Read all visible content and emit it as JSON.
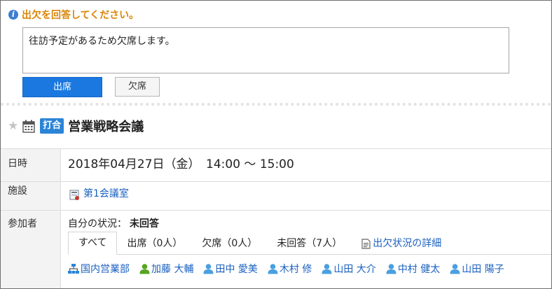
{
  "response": {
    "prompt": "出欠を回答してください。",
    "comment": "往訪予定があるため欠席します。",
    "attend_label": "出席",
    "absent_label": "欠席"
  },
  "event": {
    "menu": "打合",
    "title": "営業戦略会議"
  },
  "details": {
    "date_label": "日時",
    "date_value": "2018年04月27日（金）　14:00 ～ 15:00",
    "facility_label": "施設",
    "facility_value": "第1会議室",
    "attendees_label": "参加者",
    "own_status_label": "自分の状況：",
    "own_status_value": "未回答"
  },
  "tabs": [
    {
      "label": "すべて"
    },
    {
      "label": "出席（0人）"
    },
    {
      "label": "欠席（0人）"
    },
    {
      "label": "未回答（7人）"
    },
    {
      "label": "出欠状況の詳細"
    }
  ],
  "attendees": {
    "group": "国内営業部",
    "users": [
      "加藤 大輔",
      "田中 愛美",
      "木村 修",
      "山田 大介",
      "中村 健太",
      "山田 陽子"
    ]
  },
  "colors": {
    "accent": "#1a78e0",
    "prompt": "#d9860a",
    "link": "#1a60c0",
    "badge": "#2b84d6",
    "logged_in_user": "#55a520",
    "user": "#4a9fe0"
  }
}
